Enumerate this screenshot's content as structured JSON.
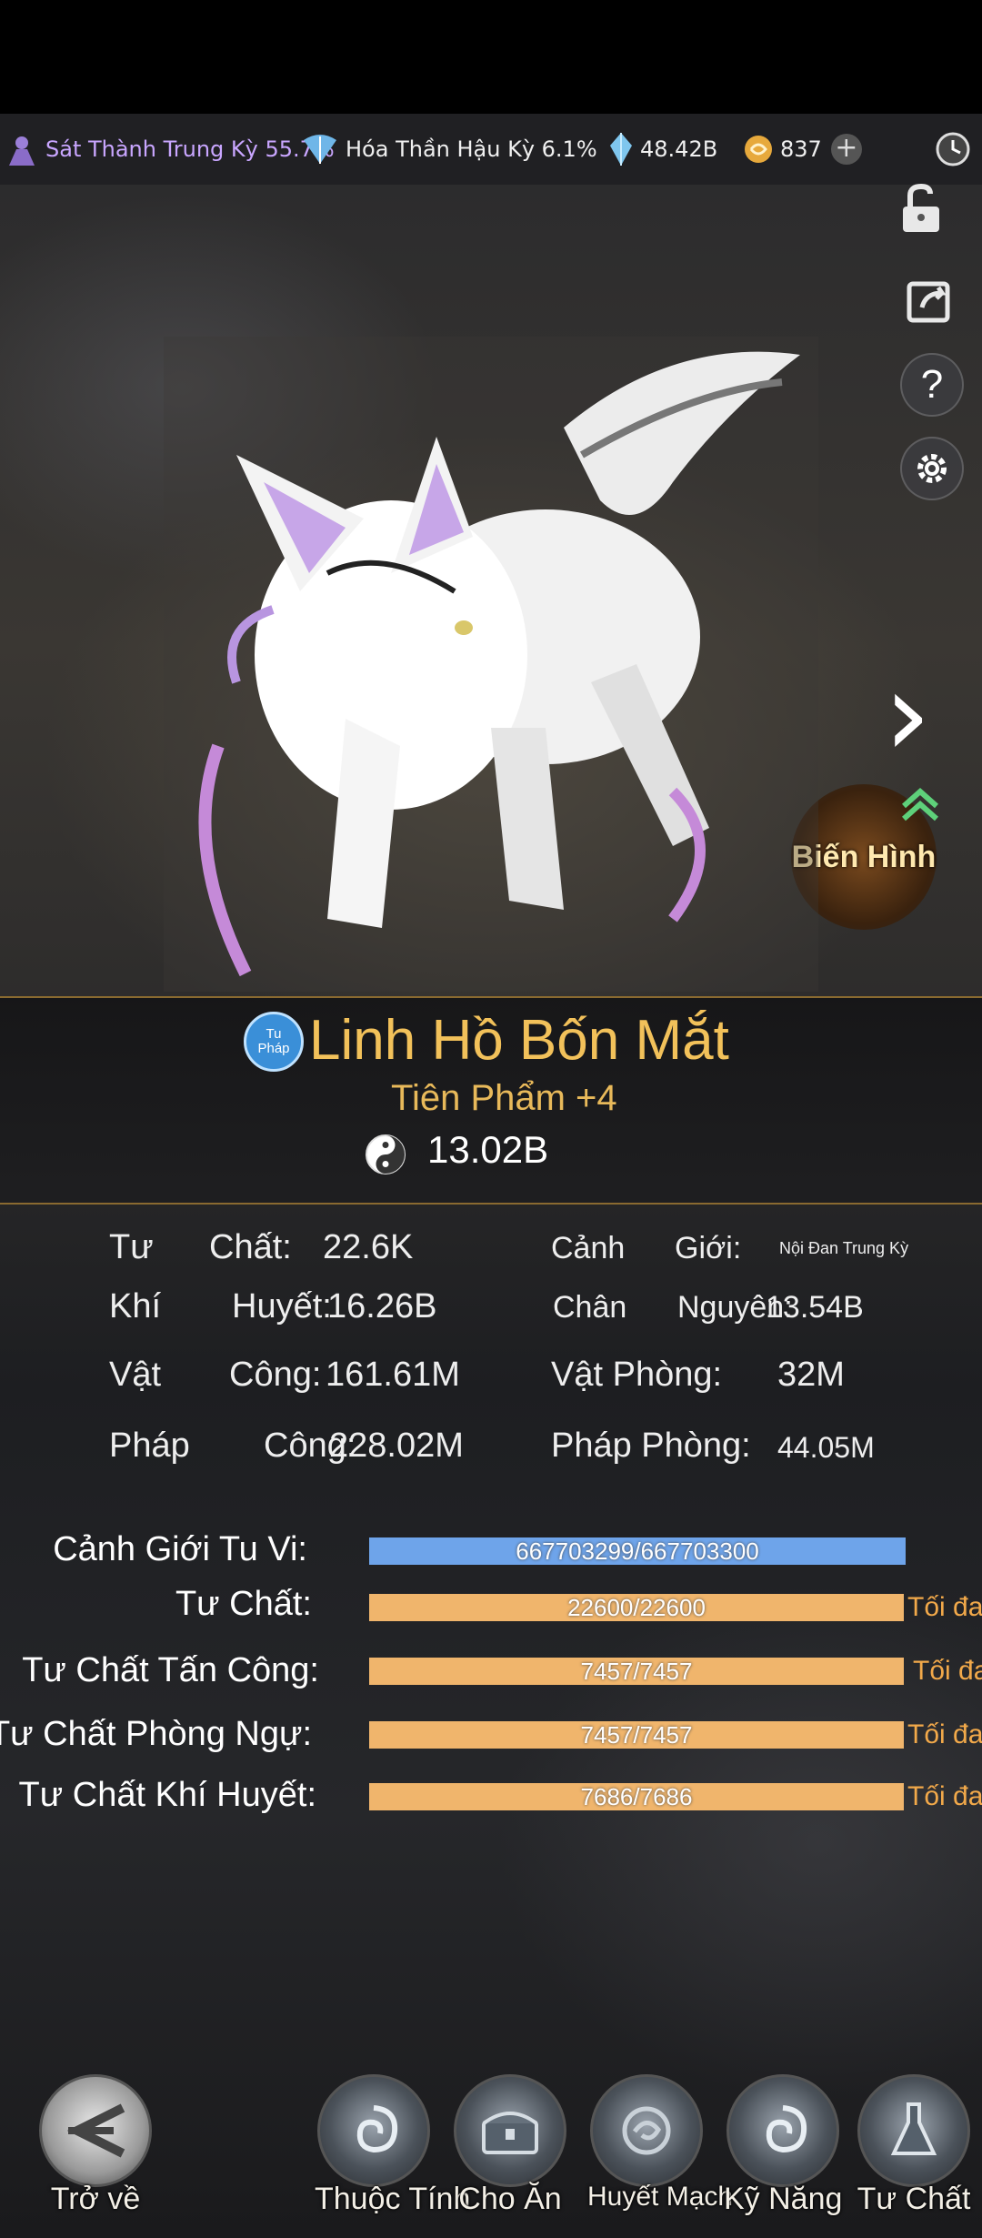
{
  "top_bar": {
    "realm_1": "Sát Thành Trung Kỳ 55.7%",
    "realm_2": "Hóa Thần Hậu Kỳ 6.1%",
    "spirit_stones": "48.42B",
    "coins": "837",
    "plus": "+"
  },
  "side_buttons": [
    "unlock-icon",
    "share-icon",
    "help-icon",
    "settings-icon"
  ],
  "next_arrow": "›",
  "transform_button": "Biến Hình",
  "pet": {
    "badge": "Tu Pháp",
    "name": "Linh Hồ Bốn Mắt",
    "grade": "Tiên Phẩm +4",
    "power": "13.02B"
  },
  "stats": {
    "tu_chat_label": "Tư",
    "tu_chat_label2": "Chất:",
    "tu_chat_value": "22.6K",
    "canh_gioi_label": "Cảnh",
    "canh_gioi_label2": "Giới:",
    "canh_gioi_value": "Nội Đan Trung Kỳ",
    "khi_huyet_label": "Khí",
    "khi_huyet_label2": "Huyết:",
    "khi_huyet_value": "16.26B",
    "chan_nguyen_label": "Chân",
    "chan_nguyen_label2": "Nguyên:",
    "chan_nguyen_value": "13.54B",
    "vat_cong_label": "Vật",
    "vat_cong_label2": "Công:",
    "vat_cong_value": "161.61M",
    "vat_phong_label": "Vật Phòng:",
    "vat_phong_value": "32M",
    "phap_cong_label": "Pháp",
    "phap_cong_label2": "Công:",
    "phap_cong_value": "228.02M",
    "phap_phong_label": "Pháp Phòng:",
    "phap_phong_value": "44.05M"
  },
  "bars": [
    {
      "label": "Cảnh Giới Tu Vi:",
      "text": "667703299/667703300",
      "progress": 0.9999999,
      "color": "#6ea4ea",
      "max": ""
    },
    {
      "label": "Tư Chất:",
      "text": "22600/22600",
      "progress": 1.0,
      "color": "#f0b56c",
      "max": "Tối đa"
    },
    {
      "label": "Tư Chất Tấn Công:",
      "text": "7457/7457",
      "progress": 1.0,
      "color": "#f0b56c",
      "max": "Tối đa"
    },
    {
      "label": "Tư Chất Phòng Ngự:",
      "text": "7457/7457",
      "progress": 1.0,
      "color": "#f0b56c",
      "max": "Tối đa"
    },
    {
      "label": "Tư Chất Khí Huyết:",
      "text": "7686/7686",
      "progress": 1.0,
      "color": "#f0b56c",
      "max": "Tối đa"
    }
  ],
  "bottom_nav": {
    "back": "Trở về",
    "attributes": "Thuộc Tính",
    "feed": "Cho Ăn",
    "bloodline": "Huyết Mạch",
    "skills": "Kỹ Năng",
    "aptitude": "Tư Chất"
  }
}
